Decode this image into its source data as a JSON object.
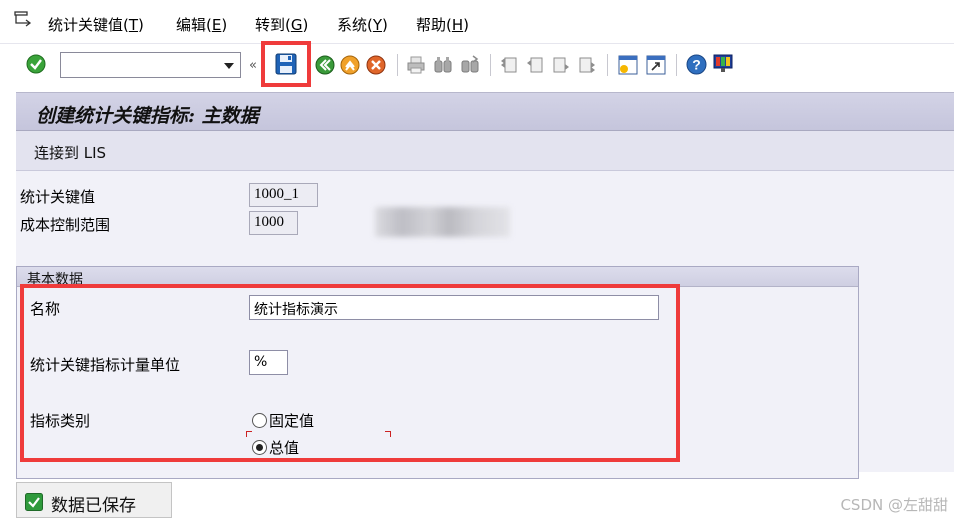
{
  "menu": {
    "items": [
      {
        "label": "统计关键值(",
        "accel": "T",
        "suffix": ")"
      },
      {
        "label": "编辑(",
        "accel": "E",
        "suffix": ")"
      },
      {
        "label": "转到(",
        "accel": "G",
        "suffix": ")"
      },
      {
        "label": "系统(",
        "accel": "Y",
        "suffix": ")"
      },
      {
        "label": "帮助(",
        "accel": "H",
        "suffix": ")"
      }
    ]
  },
  "toolbar": {
    "command_field_value": "",
    "icons": [
      "enter-icon",
      "save-icon",
      "back-icon",
      "exit-icon",
      "cancel-icon",
      "print-icon",
      "find-icon",
      "find-next-icon",
      "first-page-icon",
      "previous-page-icon",
      "next-page-icon",
      "last-page-icon",
      "new-session-icon",
      "shortcut-icon",
      "help-icon",
      "customize-layout-icon"
    ],
    "chevron": "«"
  },
  "title": "创建统计关键指标: 主数据",
  "subtoolbar": {
    "link_label": "连接到 LIS"
  },
  "header_fields": {
    "skf_label": "统计关键值",
    "skf_value": "1000_1",
    "controlling_area_label": "成本控制范围",
    "controlling_area_value": "1000"
  },
  "basic_data": {
    "group_title": "基本数据",
    "name_label": "名称",
    "name_value": "统计指标演示",
    "unit_label": "统计关键指标计量单位",
    "unit_value": "%",
    "category_label": "指标类别",
    "category_options": [
      {
        "label": "固定值",
        "selected": false
      },
      {
        "label": "总值",
        "selected": true
      }
    ]
  },
  "status": {
    "message": "数据已保存"
  },
  "watermark": "CSDN @左甜甜",
  "colors": {
    "highlight_red": "#ef3b3b",
    "title_bar": "#c9c9df",
    "success_green": "#2f9a3c"
  }
}
